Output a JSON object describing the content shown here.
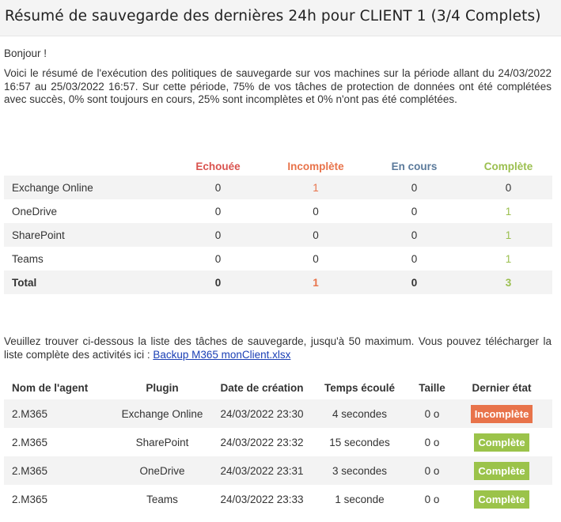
{
  "header": {
    "title": "Résumé de sauvegarde des dernières 24h pour CLIENT 1 (3/4 Complets)"
  },
  "greeting": "Bonjour !",
  "intro": "Voici le résumé de l'exécution des politiques de sauvegarde sur vos machines sur la période allant du 24/03/2022 16:57 au 25/03/2022 16:57. Sur cette période, 75% de vos tâches de protection de données ont été complétées avec succès, 0% sont toujours en cours, 25% sont incomplètes et 0% n'ont pas été complétées.",
  "summary": {
    "headers": [
      "Echouée",
      "Incomplète",
      "En cours",
      "Complète"
    ],
    "rows": [
      {
        "label": "Exchange Online",
        "values": [
          "0",
          "1",
          "0",
          "0"
        ]
      },
      {
        "label": "OneDrive",
        "values": [
          "0",
          "0",
          "0",
          "1"
        ]
      },
      {
        "label": "SharePoint",
        "values": [
          "0",
          "0",
          "0",
          "1"
        ]
      },
      {
        "label": "Teams",
        "values": [
          "0",
          "0",
          "0",
          "1"
        ]
      },
      {
        "label": "Total",
        "values": [
          "0",
          "1",
          "0",
          "3"
        ]
      }
    ]
  },
  "list_note": {
    "text": "Veuillez trouver ci-dessous la liste des tâches de sauvegarde, jusqu'à 50 maximum. Vous pouvez télécharger la liste complète des activités ici : ",
    "link": "Backup M365 monClient.xlsx"
  },
  "tasks": {
    "headers": [
      "Nom de l'agent",
      "Plugin",
      "Date de création",
      "Temps écoulé",
      "Taille",
      "Dernier état"
    ],
    "rows": [
      {
        "agent": "2.M365",
        "plugin": "Exchange Online",
        "date": "24/03/2022 23:30",
        "elapsed": "4 secondes",
        "size": "0 o",
        "status": "Incomplète"
      },
      {
        "agent": "2.M365",
        "plugin": "SharePoint",
        "date": "24/03/2022 23:32",
        "elapsed": "15 secondes",
        "size": "0 o",
        "status": "Complète"
      },
      {
        "agent": "2.M365",
        "plugin": "OneDrive",
        "date": "24/03/2022 23:31",
        "elapsed": "3 secondes",
        "size": "0 o",
        "status": "Complète"
      },
      {
        "agent": "2.M365",
        "plugin": "Teams",
        "date": "24/03/2022 23:33",
        "elapsed": "1 seconde",
        "size": "0 o",
        "status": "Complète"
      }
    ]
  },
  "colors": {
    "failed": "#d9534f",
    "incomplete": "#e8734a",
    "running": "#5b7a9b",
    "complete": "#9bbf4f",
    "stripe": "#f3f3f3",
    "link": "#1a3fb5"
  }
}
